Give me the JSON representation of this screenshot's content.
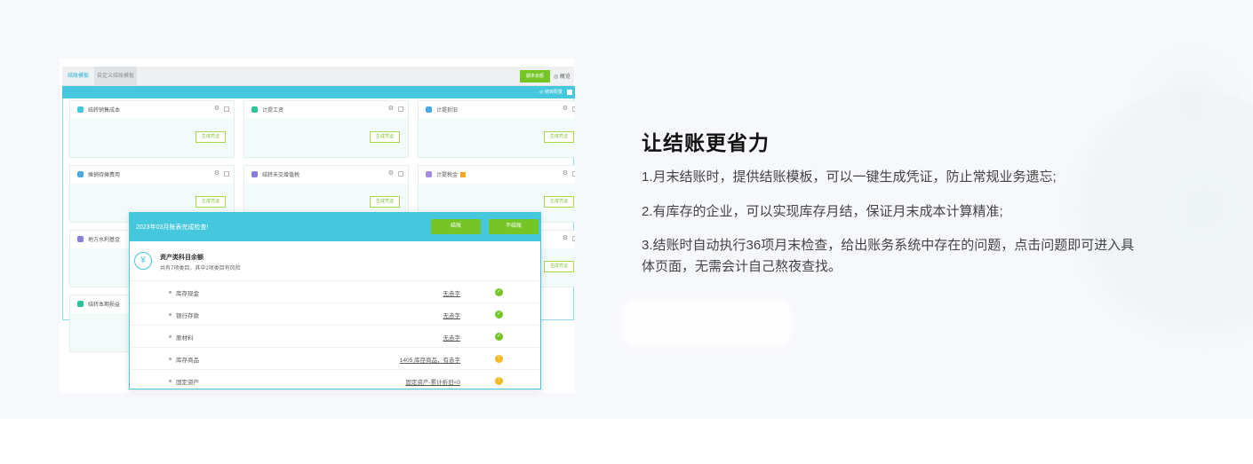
{
  "screenshot": {
    "tabs": [
      "结账模板",
      "自定义结账模板"
    ],
    "top_button": "期末余额",
    "top_link": "◎ 概览",
    "teal_bar_text": "◎ 结转配置",
    "cards": [
      {
        "label": "结转销售成本",
        "color": "#45c7de",
        "gen": "生成凭证"
      },
      {
        "label": "计提工资",
        "color": "#2cc49a",
        "gen": "生成凭证"
      },
      {
        "label": "计提折旧",
        "color": "#4aa8e8",
        "gen": "生成凭证"
      },
      {
        "label": "摊销待摊费用",
        "color": "#4aa8e8",
        "gen": "生成凭证"
      },
      {
        "label": "结转未交增值税",
        "color": "#8a7de0",
        "gen": "生成凭证"
      },
      {
        "label": "计提税金",
        "color": "#a58ae6",
        "gen": "生成凭证"
      },
      {
        "label": "地方水利基金",
        "color": "#8a7de0"
      },
      {
        "label": "结转本期损益",
        "color": "#2cc49a"
      }
    ],
    "popup": {
      "title": "2023年03月账表完成检查!",
      "btn_first": "结账",
      "btn_second": "不结账",
      "section_icon": "¥",
      "section_title": "资产类科目余额",
      "section_sub": "共有7项类目，其中2项类目有风险",
      "rows": [
        {
          "name": "库存现金",
          "link": "无赤字",
          "status": "ok"
        },
        {
          "name": "银行存款",
          "link": "无赤字",
          "status": "ok"
        },
        {
          "name": "原材料",
          "link": "无赤字",
          "status": "ok"
        },
        {
          "name": "库存商品",
          "link": "1405 库存商品，有赤字",
          "status": "warn"
        },
        {
          "name": "固定资产",
          "link": "固定资产-累计折旧<0",
          "status": "warn"
        }
      ]
    }
  },
  "content": {
    "title": "让结账更省力",
    "p1": "1.月末结账时，提供结账模板，可以一键生成凭证，防止常规业务遗忘;",
    "p2": "2.有库存的企业，可以实现库存月结，保证月末成本计算精准;",
    "p3": "3.结账时自动执行36项月末检查，给出账务系统中存在的问题，点击问题即可进入具体页面，无需会计自己熬夜查找。"
  },
  "colors": {
    "teal": "#45c7de",
    "green": "#75c527",
    "warn": "#f5b921",
    "section_bg": "#f7f8fc"
  }
}
